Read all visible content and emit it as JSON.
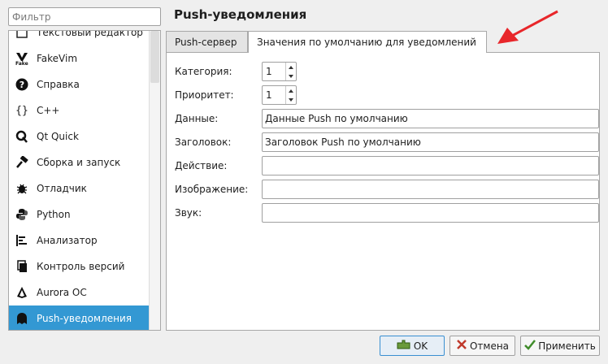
{
  "filter": {
    "placeholder": "Фильтр"
  },
  "sidebar": {
    "items": [
      {
        "label": "Текстовый редактор",
        "icon": "text-editor-icon"
      },
      {
        "label": "FakeVim",
        "icon": "fakevim-icon"
      },
      {
        "label": "Справка",
        "icon": "help-icon"
      },
      {
        "label": "C++",
        "icon": "braces-icon"
      },
      {
        "label": "Qt Quick",
        "icon": "qt-quick-icon"
      },
      {
        "label": "Сборка и запуск",
        "icon": "hammer-icon"
      },
      {
        "label": "Отладчик",
        "icon": "bug-icon"
      },
      {
        "label": "Python",
        "icon": "python-icon"
      },
      {
        "label": "Анализатор",
        "icon": "analyzer-icon"
      },
      {
        "label": "Контроль версий",
        "icon": "version-control-icon"
      },
      {
        "label": "Aurora OC",
        "icon": "aurora-icon"
      },
      {
        "label": "Push-уведомления",
        "icon": "push-bell-icon",
        "selected": true
      }
    ]
  },
  "page": {
    "title": "Push-уведомления"
  },
  "tabs": [
    {
      "label": "Push-сервер",
      "active": false
    },
    {
      "label": "Значения по умолчанию для уведомлений",
      "active": true
    }
  ],
  "form": {
    "category": {
      "label": "Категория:",
      "value": "1"
    },
    "priority": {
      "label": "Приоритет:",
      "value": "1"
    },
    "data": {
      "label": "Данные:",
      "value": "Данные Push по умолчанию"
    },
    "title": {
      "label": "Заголовок:",
      "value": "Заголовок Push по умолчанию"
    },
    "action": {
      "label": "Действие:",
      "value": ""
    },
    "image": {
      "label": "Изображение:",
      "value": ""
    },
    "sound": {
      "label": "Звук:",
      "value": ""
    }
  },
  "buttons": {
    "ok": "OK",
    "cancel": "Отмена",
    "apply": "Применить"
  },
  "colors": {
    "selection": "#3398d3",
    "annotation_arrow": "#e8262a"
  }
}
